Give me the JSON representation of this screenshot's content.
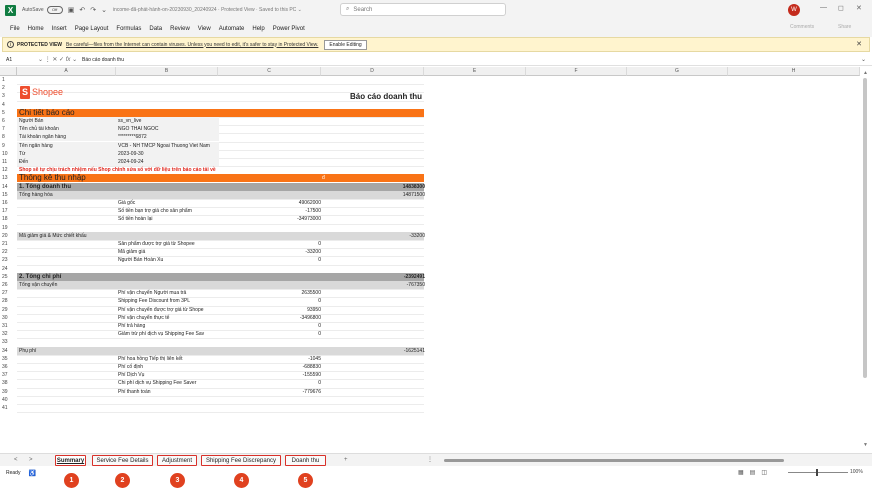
{
  "titlebar": {
    "autosave_label": "AutoSave",
    "autosave_state": "Off",
    "filename": "income-đã-phát-hành-on-20230930_20240924  ·  Protected View  ·  Saved to this PC  ⌄",
    "search_placeholder": "Search",
    "avatar": "W",
    "minimize": "—",
    "restore": "◻",
    "close": "✕"
  },
  "ribbon": {
    "tabs": [
      "File",
      "Home",
      "Insert",
      "Page Layout",
      "Formulas",
      "Data",
      "Review",
      "View",
      "Automate",
      "Help",
      "Power Pivot"
    ],
    "comments_label": "Comments",
    "share_label": "Share"
  },
  "protected_view": {
    "title": "PROTECTED VIEW",
    "message": "Be careful—files from the Internet can contain viruses. Unless you need to edit, it's safer to stay in Protected View.",
    "enable_button": "Enable Editing",
    "close": "✕"
  },
  "formula_bar": {
    "name_box": "A1",
    "fx": "fx",
    "value": "Báo cáo doanh thu"
  },
  "columns": [
    {
      "label": "A"
    },
    {
      "label": "B"
    },
    {
      "label": "C"
    },
    {
      "label": "D"
    },
    {
      "label": "E"
    },
    {
      "label": "F"
    },
    {
      "label": "G"
    },
    {
      "label": "H"
    }
  ],
  "logo": {
    "text": "Shopee"
  },
  "report_title": "Báo cáo doanh thu",
  "rows": [
    {
      "n": "1"
    },
    {
      "n": "2"
    },
    {
      "n": "3"
    },
    {
      "n": "4"
    },
    {
      "n": "5",
      "style": "orange-header",
      "a": "Chi tiết báo cáo"
    },
    {
      "n": "6",
      "style": "info",
      "a": "Người Bán",
      "b": "ss_vn_live"
    },
    {
      "n": "7",
      "style": "info",
      "a": "Tên chủ tài khoản",
      "b": "NGO THAI NGOC"
    },
    {
      "n": "8",
      "style": "info",
      "a": "Tài khoản ngân hàng",
      "b": "*********6872"
    },
    {
      "n": "9",
      "style": "info",
      "a": "Tên ngân hàng",
      "b": "VCB - NH TMCP Ngoai Thuong Viet Nam"
    },
    {
      "n": "10",
      "style": "info",
      "a": "Từ",
      "b": "2023-09-30"
    },
    {
      "n": "11",
      "style": "info",
      "a": "Đến",
      "b": "2024-09-24"
    },
    {
      "n": "12",
      "style": "red-note",
      "a": "Shop sẽ tự chịu trách nhiệm nếu Shop chỉnh sửa số với dữ liệu trên báo cáo tải về"
    },
    {
      "n": "13",
      "style": "orange-header",
      "a": "Thống kê thu nhập",
      "dmark": "đ"
    },
    {
      "n": "14",
      "style": "section-dark",
      "a": "1. Tổng doanh thu",
      "d": "14838300"
    },
    {
      "n": "15",
      "style": "section-light",
      "a": "Tổng hàng hóa",
      "d": "14871500"
    },
    {
      "n": "16",
      "b": "Giá gốc",
      "c": "49062000"
    },
    {
      "n": "17",
      "b": "Số tiền bạn trợ giá cho sản phẩm",
      "c": "-17500"
    },
    {
      "n": "18",
      "b": "Số tiền hoàn lại",
      "c": "-34973000"
    },
    {
      "n": "19"
    },
    {
      "n": "20",
      "style": "section-light",
      "a": "Mã giảm giá & Mức chiết khấu",
      "d": "-33200"
    },
    {
      "n": "21",
      "b": "Sản phẩm được trợ giá từ Shopee",
      "c": "0"
    },
    {
      "n": "22",
      "b": "Mã giảm giá",
      "c": "-33200"
    },
    {
      "n": "23",
      "b": "Người Bán Hoàn Xu",
      "c": "0"
    },
    {
      "n": "24"
    },
    {
      "n": "25",
      "style": "section-dark",
      "a": "2. Tổng chi phí",
      "d": "-2392491"
    },
    {
      "n": "26",
      "style": "section-light",
      "a": "Tổng vận chuyển",
      "d": "-767350"
    },
    {
      "n": "27",
      "b": "Phí vận chuyển Người mua trả",
      "c": "2635500"
    },
    {
      "n": "28",
      "b": "Shipping Fee Discount from 3PL",
      "c": "0"
    },
    {
      "n": "29",
      "b": "Phí vận chuyển được trợ giá từ Shope",
      "c": "93950"
    },
    {
      "n": "30",
      "b": "Phí vận chuyển thực tế",
      "c": "-3496800"
    },
    {
      "n": "31",
      "b": "Phí trả hàng",
      "c": "0"
    },
    {
      "n": "32",
      "b": "Giảm trừ phí dịch vụ Shipping Fee Sav",
      "c": "0"
    },
    {
      "n": "33"
    },
    {
      "n": "34",
      "style": "section-light",
      "a": "Phụ phí",
      "d": "-1625141"
    },
    {
      "n": "35",
      "b": "Phí hoa hồng Tiếp thị liên kết",
      "c": "-1045"
    },
    {
      "n": "36",
      "b": "Phí cố định",
      "c": "-688830"
    },
    {
      "n": "37",
      "b": "Phí Dịch Vụ",
      "c": "-155590"
    },
    {
      "n": "38",
      "b": "Chi phí dịch vụ Shipping Fee Saver",
      "c": "0"
    },
    {
      "n": "39",
      "b": "Phí thanh toán",
      "c": "-779676"
    },
    {
      "n": "40"
    },
    {
      "n": "41"
    }
  ],
  "sheet_tabs": [
    {
      "label": "Summary",
      "active": true,
      "badge": "1"
    },
    {
      "label": "Service Fee Details",
      "active": false,
      "badge": "2"
    },
    {
      "label": "Adjustment",
      "active": false,
      "badge": "3"
    },
    {
      "label": "Shipping Fee Discrepancy",
      "active": false,
      "badge": "4"
    },
    {
      "label": "Doanh thu",
      "active": false,
      "badge": "5"
    }
  ],
  "status": {
    "ready": "Ready",
    "zoom": "100%"
  },
  "colors": {
    "orange": "#f97316",
    "section_dark": "#a6a6a6",
    "section_light": "#d9d9d9",
    "info_bg": "#f2f2f2",
    "red_note": "#e0251b",
    "badge": "#e0411f",
    "shopee": "#ee4d2d"
  }
}
